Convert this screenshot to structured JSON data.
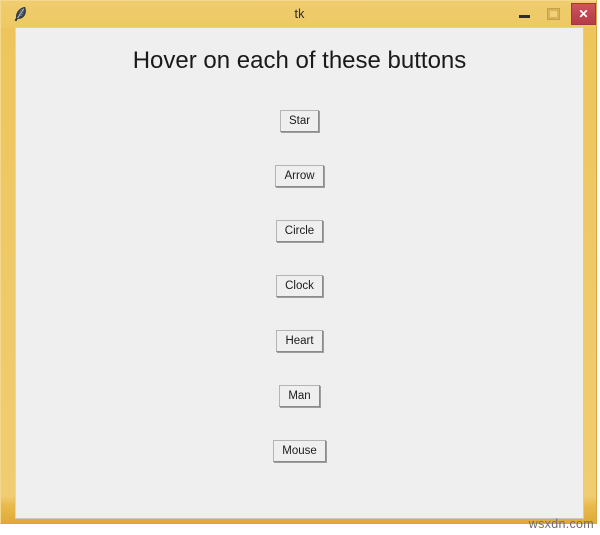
{
  "window": {
    "title": "tk",
    "icon": "feather-icon",
    "frame_color": "#eec863",
    "client_bg": "#efefef",
    "controls": {
      "minimize_label": "–",
      "maximize_label": "□",
      "close_label": "✕",
      "close_color": "#bf4550"
    }
  },
  "main": {
    "heading": "Hover on each of these buttons",
    "buttons": [
      {
        "label": "Star"
      },
      {
        "label": "Arrow"
      },
      {
        "label": "Circle"
      },
      {
        "label": "Clock"
      },
      {
        "label": "Heart"
      },
      {
        "label": "Man"
      },
      {
        "label": "Mouse"
      }
    ]
  },
  "watermark": {
    "text": "wsxdn.com"
  }
}
